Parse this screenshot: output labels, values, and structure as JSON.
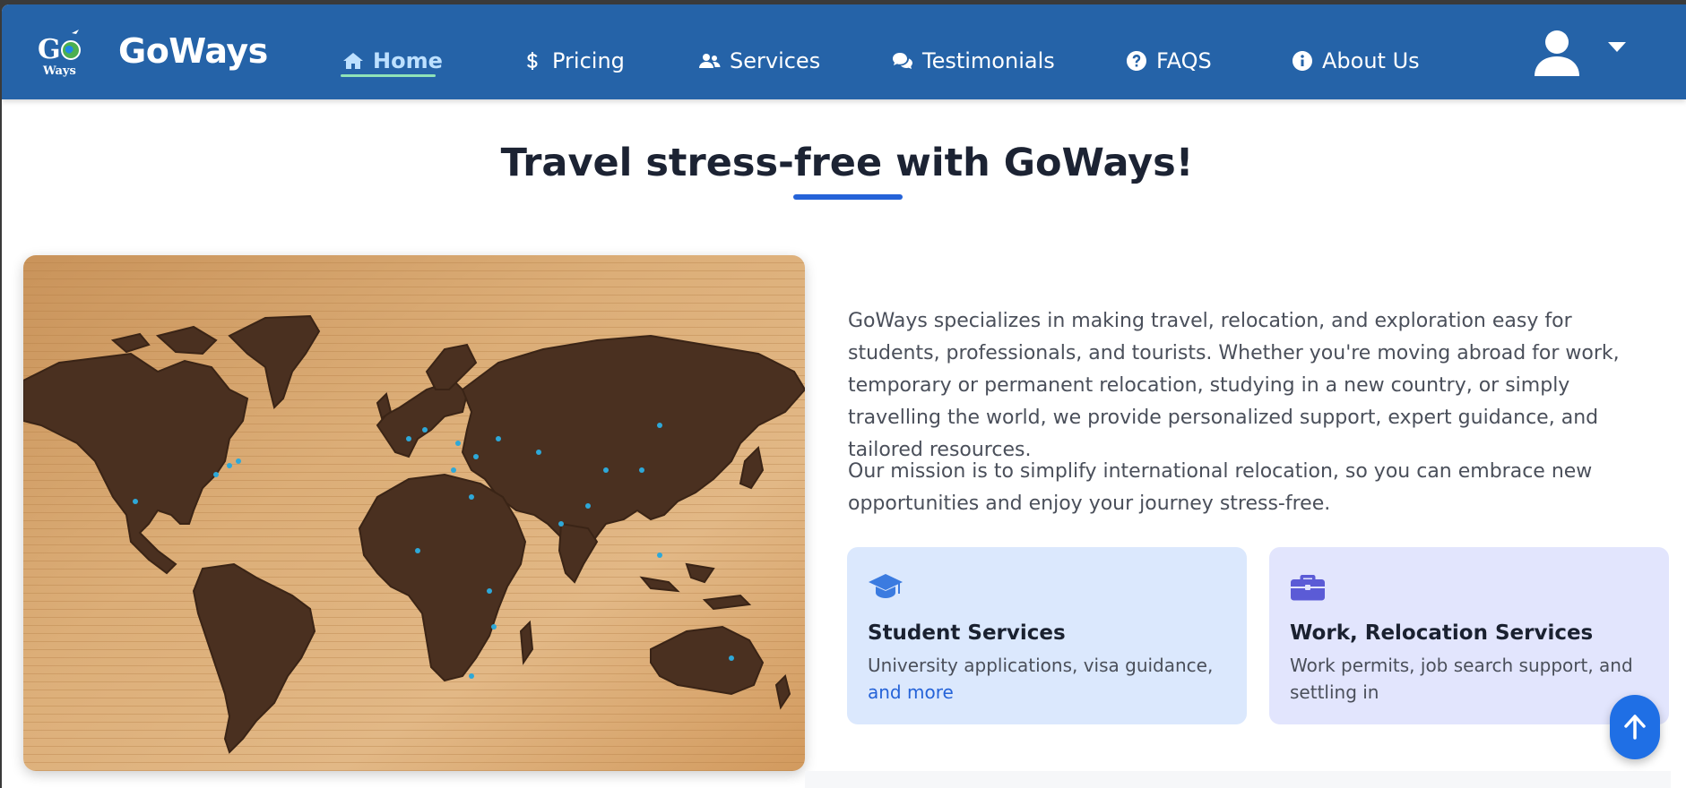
{
  "brand": {
    "name": "GoWays",
    "logo_text_top": "Go",
    "logo_text_bottom": "Ways"
  },
  "nav": {
    "items": [
      {
        "label": "Home",
        "icon": "home-icon",
        "active": true
      },
      {
        "label": "Pricing",
        "icon": "dollar-icon",
        "active": false
      },
      {
        "label": "Services",
        "icon": "users-icon",
        "active": false
      },
      {
        "label": "Testimonials",
        "icon": "comments-icon",
        "active": false
      },
      {
        "label": "FAQS",
        "icon": "question-circle-icon",
        "active": false
      },
      {
        "label": "About Us",
        "icon": "info-circle-icon",
        "active": false
      }
    ],
    "user_icon": "user-icon",
    "dropdown_icon": "caret-down-icon"
  },
  "hero": {
    "title": "Travel stress-free with GoWays!",
    "paragraph1": "GoWays specializes in making travel, relocation, and exploration easy for students, professionals, and tourists. Whether you're moving abroad for work, temporary or permanent relocation, studying in a new country, or simply travelling the world, we provide personalized support, expert guidance, and tailored resources.",
    "paragraph2": "Our mission is to simplify international relocation, so you can embrace new opportunities and enjoy your journey stress-free."
  },
  "cards": [
    {
      "icon": "graduation-cap-icon",
      "title": "Student Services",
      "desc_plain": "University applications, visa guidance, ",
      "desc_link": "and more",
      "color": "#dbe8fd"
    },
    {
      "icon": "briefcase-icon",
      "title": "Work, Relocation Services",
      "desc_plain": "Work permits, job search support, and settling in",
      "color": "#e2e5fd"
    }
  ],
  "colors": {
    "navbar": "#2563a8",
    "accent": "#2563d8",
    "active_nav": "#bde0ff",
    "underline": "#8fe3b8"
  },
  "scroll_top_icon": "arrow-up-icon"
}
